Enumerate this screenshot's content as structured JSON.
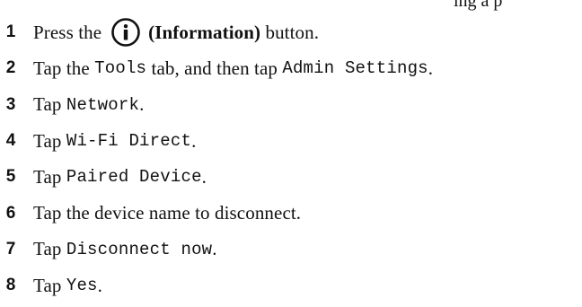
{
  "header_fragment": "ing a p",
  "steps": [
    {
      "num": "1",
      "prefix": "Press the",
      "paren_bold": "(Information)",
      "suffix": "button.",
      "icon": "info-circle-icon"
    },
    {
      "num": "2",
      "p1": "Tap the ",
      "m1": "Tools",
      "p2": " tab, and then tap ",
      "m2": "Admin Settings",
      "p3": "."
    },
    {
      "num": "3",
      "p1": "Tap ",
      "m1": "Network",
      "p2": "."
    },
    {
      "num": "4",
      "p1": "Tap ",
      "m1": "Wi-Fi Direct",
      "p2": "."
    },
    {
      "num": "5",
      "p1": "Tap ",
      "m1": "Paired Device",
      "p2": "."
    },
    {
      "num": "6",
      "p1": "Tap the device name to disconnect."
    },
    {
      "num": "7",
      "p1": "Tap ",
      "m1": "Disconnect now",
      "p2": "."
    },
    {
      "num": "8",
      "p1": "Tap ",
      "m1": "Yes",
      "p2": "."
    }
  ]
}
